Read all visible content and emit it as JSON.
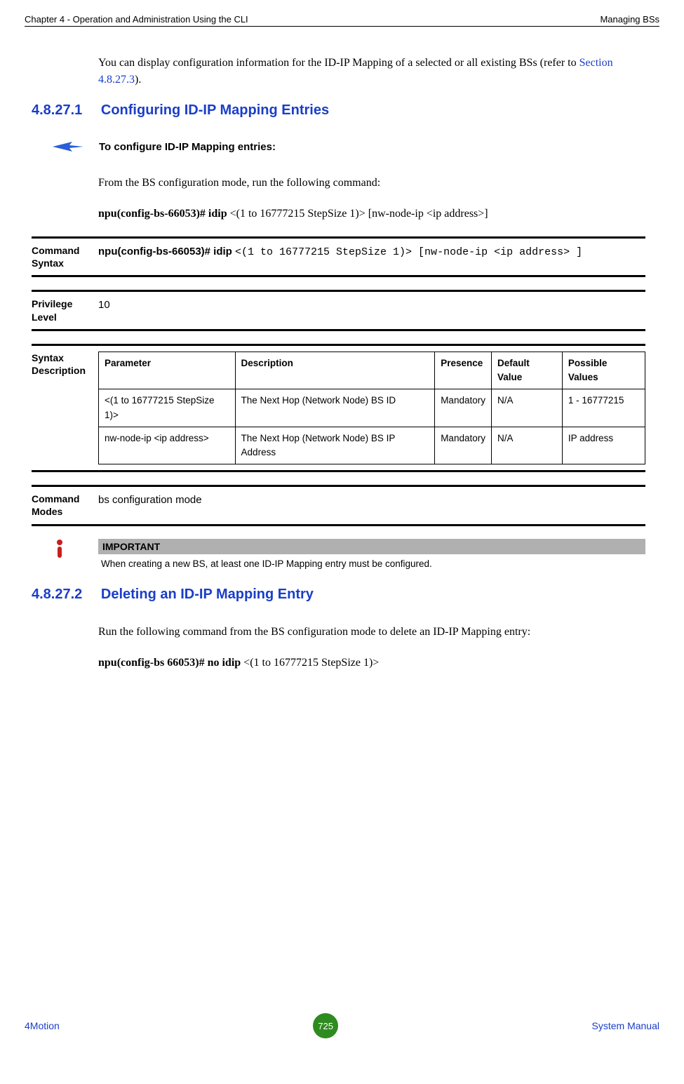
{
  "header": {
    "left": "Chapter 4 - Operation and Administration Using the CLI",
    "right": "Managing BSs"
  },
  "intro": {
    "p1_a": "You can display configuration information for the ID-IP Mapping of a selected or all existing BSs (refer to ",
    "p1_link": "Section 4.8.27.3",
    "p1_b": ")."
  },
  "sec1": {
    "num": "4.8.27.1",
    "title": "Configuring ID-IP Mapping Entries",
    "arrow_text": "To configure ID-IP Mapping entries:",
    "p_from": "From the BS configuration mode, run the following command:",
    "p_cmd_bold": "npu(config-bs-66053)# idip ",
    "p_cmd_rest": "<(1 to 16777215 StepSize 1)> [nw-node-ip <ip address>]"
  },
  "blocks": {
    "cmd_syntax_label": "Command Syntax",
    "cmd_syntax_bold": "npu(config-bs-66053)# idip ",
    "cmd_syntax_mono": "<(1 to 16777215 StepSize 1)> [nw-node-ip <ip address> ]",
    "priv_label": "Privilege Level",
    "priv_value": "10",
    "syntax_desc_label": "Syntax Description",
    "cmd_modes_label": "Command Modes",
    "cmd_modes_value": "bs configuration mode"
  },
  "table": {
    "headers": {
      "param": "Parameter",
      "desc": "Description",
      "pres": "Presence",
      "def": "Default Value",
      "poss": "Possible Values"
    },
    "rows": [
      {
        "param": "<(1 to 16777215 StepSize 1)>",
        "desc": "The Next Hop (Network Node) BS ID",
        "pres": "Mandatory",
        "def": "N/A",
        "poss": "1 - 16777215"
      },
      {
        "param": "nw-node-ip <ip address>",
        "desc": "The Next Hop (Network Node) BS IP Address",
        "pres": "Mandatory",
        "def": "N/A",
        "poss": "IP address"
      }
    ]
  },
  "important": {
    "title": "IMPORTANT",
    "text": "When creating a new BS, at least one ID-IP Mapping entry must be configured."
  },
  "sec2": {
    "num": "4.8.27.2",
    "title": "Deleting an ID-IP Mapping Entry",
    "p1": "Run the following command from the BS configuration mode to delete an ID-IP Mapping entry:",
    "p2_bold": "npu(config-bs 66053)# no idip ",
    "p2_rest": "<(1 to 16777215 StepSize 1)>"
  },
  "footer": {
    "left": "4Motion",
    "page": "725",
    "right": "System Manual"
  }
}
